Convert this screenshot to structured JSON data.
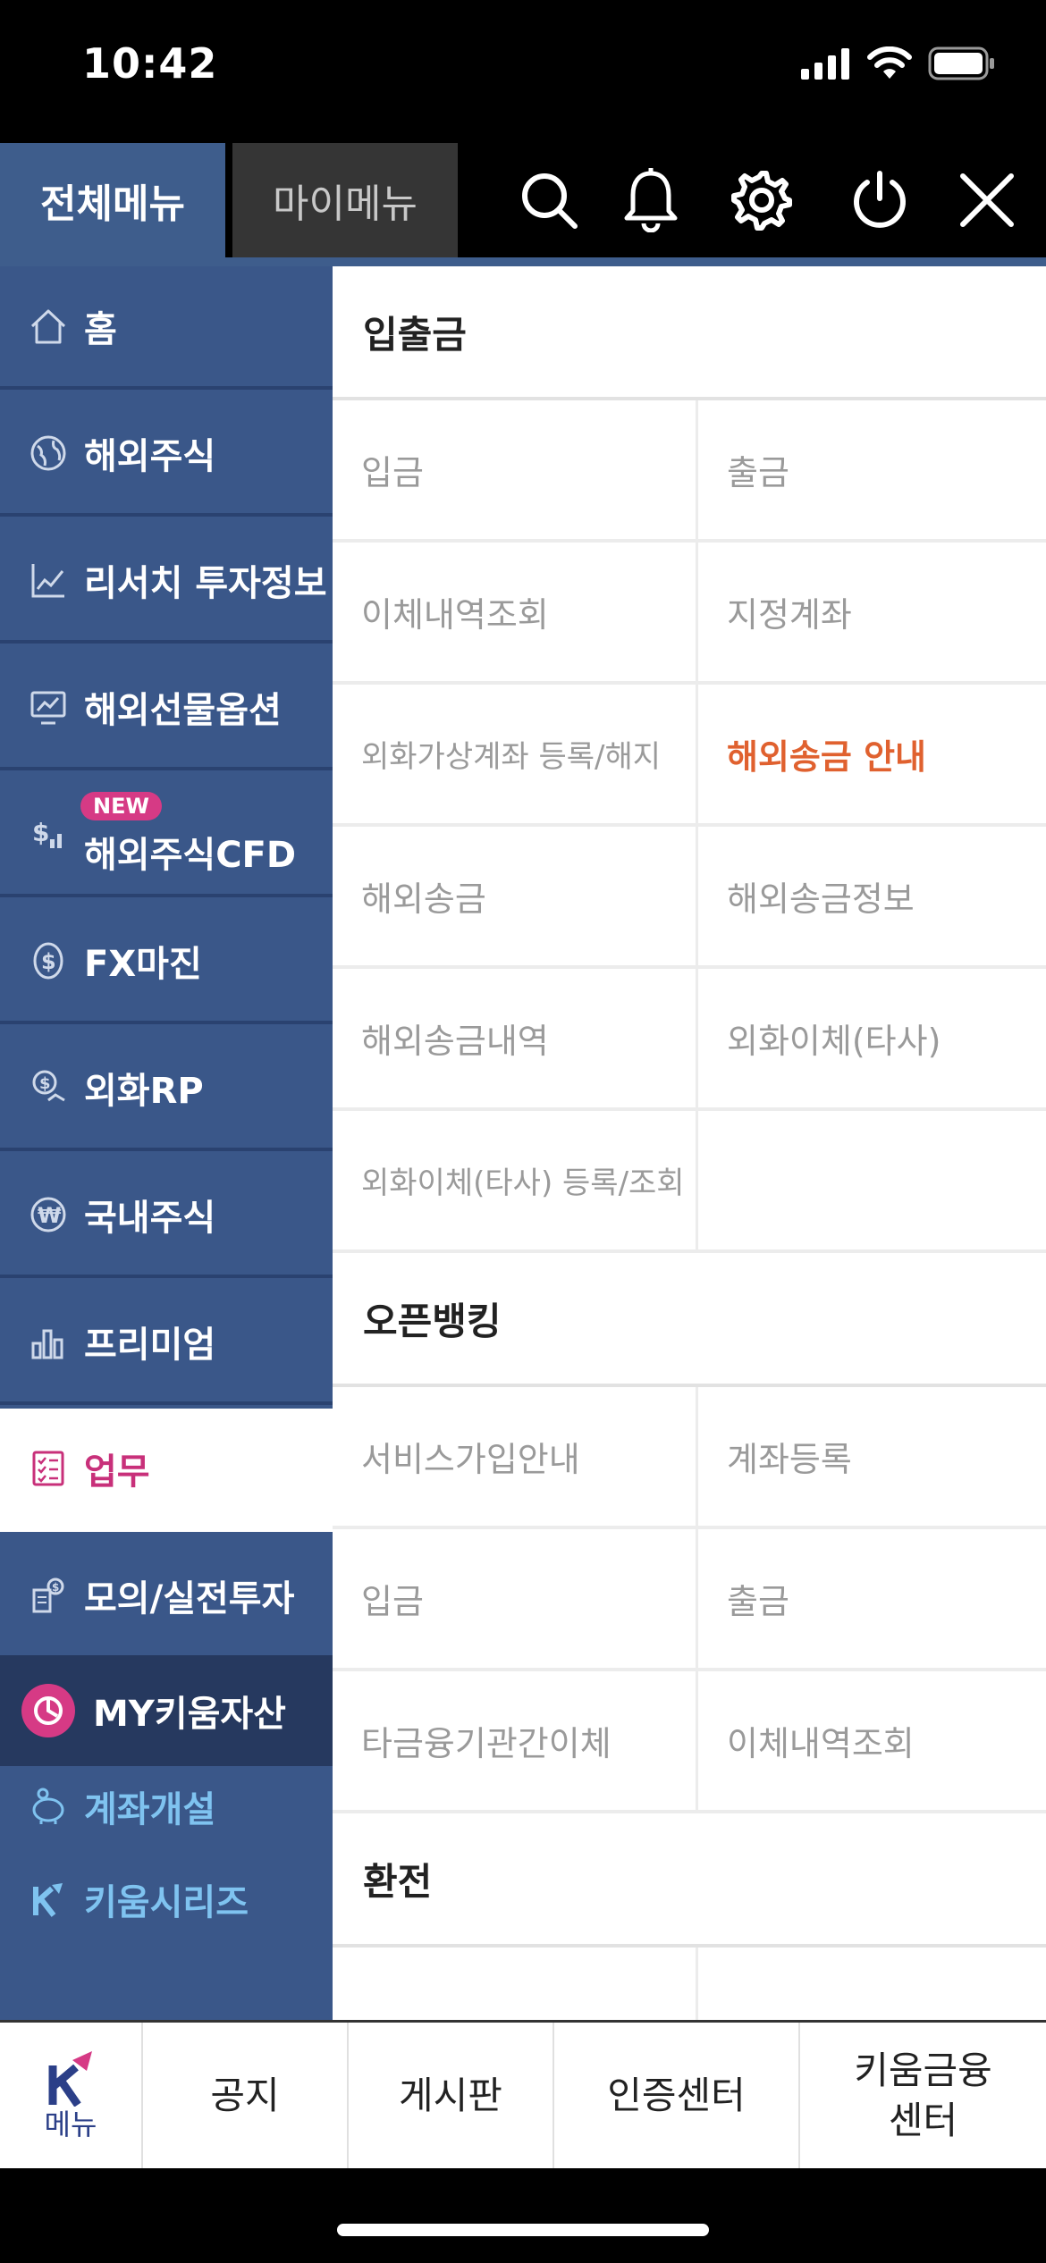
{
  "status": {
    "time": "10:42"
  },
  "header": {
    "tab_all": "전체메뉴",
    "tab_my": "마이메뉴",
    "icons": [
      "search-icon",
      "bell-icon",
      "gear-icon",
      "power-icon",
      "close-icon"
    ]
  },
  "sidebar": {
    "items": [
      {
        "label": "홈",
        "icon": "home-icon"
      },
      {
        "label": "해외주식",
        "icon": "globe-icon"
      },
      {
        "label": "리서치 투자정보",
        "icon": "line-chart-icon"
      },
      {
        "label": "해외선물옵션",
        "icon": "monitor-chart-icon"
      },
      {
        "label": "해외주식CFD",
        "icon": "dollar-chart-icon",
        "badge": "NEW"
      },
      {
        "label": "FX마진",
        "icon": "dollar-circle-icon"
      },
      {
        "label": "외화RP",
        "icon": "coin-hand-icon"
      },
      {
        "label": "국내주식",
        "icon": "won-icon"
      },
      {
        "label": "프리미엄",
        "icon": "bar-chart-icon"
      },
      {
        "label": "업무",
        "icon": "checklist-icon",
        "active": true
      },
      {
        "label": "모의/실전투자",
        "icon": "money-stack-icon"
      }
    ],
    "my_assets": "MY키움자산",
    "sub_items": [
      {
        "label": "계좌개설",
        "icon": "piggy-bank-icon"
      },
      {
        "label": "키움시리즈",
        "icon": "kiwoom-k-icon"
      }
    ]
  },
  "content": {
    "sections": [
      {
        "title": "입출금",
        "rows": [
          [
            "입금",
            "출금"
          ],
          [
            "이체내역조회",
            "지정계좌"
          ],
          [
            "외화가상계좌 등록/해지",
            "해외송금 안내"
          ],
          [
            "해외송금",
            "해외송금정보"
          ],
          [
            "해외송금내역",
            "외화이체(타사)"
          ],
          [
            "외화이체(타사) 등록/조회",
            ""
          ]
        ]
      },
      {
        "title": "오픈뱅킹",
        "rows": [
          [
            "서비스가입안내",
            "계좌등록"
          ],
          [
            "입금",
            "출금"
          ],
          [
            "타금융기관간이체",
            "이체내역조회"
          ]
        ]
      },
      {
        "title": "환전",
        "rows": []
      }
    ],
    "highlight_color": "#e0612f"
  },
  "bottom": {
    "menu_label": "메뉴",
    "items": [
      "공지",
      "게시판",
      "인증센터"
    ],
    "last_item_line1": "키움금융",
    "last_item_line2": "센터"
  },
  "colors": {
    "sidebar_bg": "#3a5789",
    "active_text": "#c8307a",
    "badge": "#d63a85",
    "sub_text": "#7fc3f0"
  }
}
